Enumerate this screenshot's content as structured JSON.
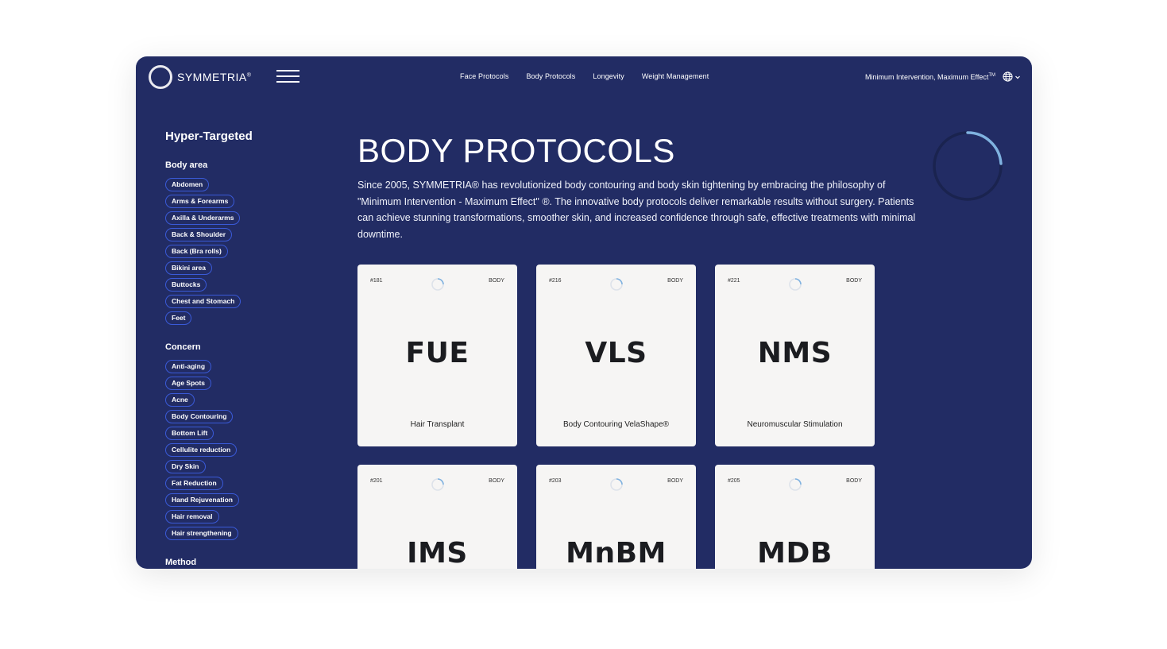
{
  "header": {
    "logo_text": "SYMMETRIA",
    "logo_mark": "®",
    "nav": [
      "Face Protocols",
      "Body Protocols",
      "Longevity",
      "Weight Management"
    ],
    "tagline": "Minimum Intervention, Maximum Effect",
    "tagline_mark": "TM",
    "language_icon": "globe-icon"
  },
  "sidebar": {
    "title": "Hyper-Targeted",
    "body_area": {
      "heading": "Body area",
      "items": [
        "Abdomen",
        "Arms & Forearms",
        "Axilla & Underarms",
        "Back & Shoulder",
        "Back (Bra rolls)",
        "Bikini area",
        "Buttocks",
        "Chest and Stomach",
        "Feet"
      ]
    },
    "concern": {
      "heading": "Concern",
      "items": [
        "Anti-aging",
        "Age Spots",
        "Acne",
        "Body Contouring",
        "Bottom Lift",
        "Cellulite reduction",
        "Dry Skin",
        "Fat Reduction",
        "Hand Rejuvenation",
        "Hair removal",
        "Hair strengthening"
      ]
    },
    "method_heading": "Method"
  },
  "main": {
    "title": "BODY PROTOCOLS",
    "intro": "Since 2005, SYMMETRIA® has revolutionized body contouring and body skin tightening by embracing the philosophy of \"Minimum Intervention - Maximum Effect\" ®. The innovative body protocols deliver remarkable results without surgery. Patients can achieve stunning transformations, smoother skin, and increased confidence through safe, effective treatments with minimal downtime.",
    "cards": [
      {
        "number": "#181",
        "tag": "BODY",
        "code": "FUE",
        "name": "Hair Transplant"
      },
      {
        "number": "#216",
        "tag": "BODY",
        "code": "VLS",
        "name": "Body Contouring VelaShape®"
      },
      {
        "number": "#221",
        "tag": "BODY",
        "code": "NMS",
        "name": "Neuromuscular Stimulation"
      },
      {
        "number": "#201",
        "tag": "BODY",
        "code": "IMS",
        "name": ""
      },
      {
        "number": "#203",
        "tag": "BODY",
        "code": "MnBM",
        "name": ""
      },
      {
        "number": "#205",
        "tag": "BODY",
        "code": "MDB",
        "name": ""
      }
    ]
  },
  "colors": {
    "background": "#222c64",
    "chip_border": "#3a5ad8",
    "card": "#f6f5f4",
    "spinner_accent": "#7fb2e0"
  }
}
